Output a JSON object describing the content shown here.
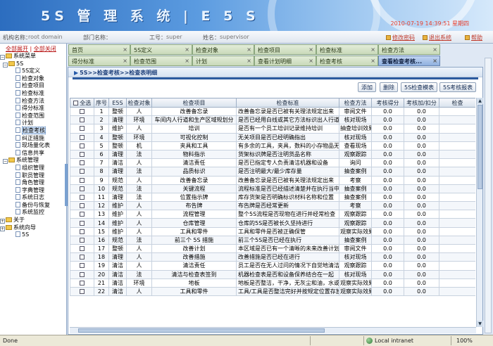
{
  "banner": {
    "title": "5S 管 理 系 统 | E 5 S",
    "datetime": "2010-07-19 14:39:51 星期四"
  },
  "infobar": {
    "org_label": "机构名称：",
    "org_value": "root domain",
    "dept_label": "部门名称：",
    "dept_value": "",
    "emp_label": "工号：",
    "emp_value": "super",
    "name_label": "姓名：",
    "name_value": "supervisor",
    "change_pwd": "修改密码",
    "logout": "退出系统",
    "help": "帮助"
  },
  "sidebar": {
    "expand_all": "全部展开",
    "collapse_all": "全部关闭",
    "items": [
      {
        "label": "系统菜单",
        "level": 0,
        "type": "folder"
      },
      {
        "label": "5S",
        "level": 1,
        "type": "folder"
      },
      {
        "label": "5S定义",
        "level": 2
      },
      {
        "label": "检查对象",
        "level": 2
      },
      {
        "label": "检查项目",
        "level": 2
      },
      {
        "label": "检查标准",
        "level": 2
      },
      {
        "label": "检查方法",
        "level": 2
      },
      {
        "label": "得分标准",
        "level": 2
      },
      {
        "label": "检查范围",
        "level": 2
      },
      {
        "label": "计划",
        "level": 2
      },
      {
        "label": "检查考核",
        "level": 2,
        "selected": true
      },
      {
        "label": "纠正措施",
        "level": 2
      },
      {
        "label": "现场量化表",
        "level": 2
      },
      {
        "label": "信息共享",
        "level": 2
      },
      {
        "label": "系统管理",
        "level": 1,
        "type": "folder"
      },
      {
        "label": "组织管理",
        "level": 2
      },
      {
        "label": "职员管理",
        "level": 2
      },
      {
        "label": "角色管理",
        "level": 2
      },
      {
        "label": "字典管理",
        "level": 2
      },
      {
        "label": "系统日志",
        "level": 2
      },
      {
        "label": "备份与恢复",
        "level": 2
      },
      {
        "label": "系统监控",
        "level": 2
      },
      {
        "label": "关于",
        "level": 0,
        "type": "folder"
      },
      {
        "label": "系统向导",
        "level": 0,
        "type": "folder"
      },
      {
        "label": "5S",
        "level": 2
      }
    ]
  },
  "tabs": {
    "row1": [
      "首页",
      "5S定义",
      "检查对象",
      "检查项目",
      "检查标准",
      "检查方法"
    ],
    "row2": [
      "得分标准",
      "检查范围",
      "计划",
      "查看计划明细",
      "检查考核",
      "查看检查考核..."
    ],
    "active": "查看检查考核..."
  },
  "content": {
    "breadcrumb": "5S>>检查考核>>检查表明细",
    "buttons": {
      "add": "添加",
      "delete": "删除",
      "tpl": "5S检查模表",
      "report": "5S考核报表"
    },
    "columns": [
      "全选",
      "序号",
      "E5S",
      "检查对象",
      "检查项目",
      "检查标准",
      "检查方法",
      "考核得分",
      "考核加/扣分",
      "检查"
    ],
    "rows": [
      [
        "1",
        "整顿",
        "人",
        "改善备忘录",
        "改善备忘录是否已被有关理法规定出来",
        "审阅文件",
        "0.0",
        "0.0"
      ],
      [
        "2",
        "清理",
        "环境",
        "车间内人行道和生产区域规划分",
        "是否已经用白线或其它方法标识出人行道和生产区",
        "核对现场",
        "0.0",
        "0.0"
      ],
      [
        "3",
        "维护",
        "人",
        "培训",
        "是否有一个员工培训记录维持培训",
        "抽查培训效果",
        "0.0",
        "0.0"
      ],
      [
        "4",
        "整顿",
        "环境",
        "可视化控制",
        "无关项目是否已经明确指出",
        "核对现场",
        "0.0",
        "0.0"
      ],
      [
        "5",
        "整顿",
        "机",
        "夹具和工具",
        "有多余的工具，夹具，数料的小存物品无围围",
        "查看现场",
        "0.0",
        "0.0"
      ],
      [
        "6",
        "清理",
        "法",
        "物料指示",
        "货架标识牌是否注明货品名称",
        "观察跟踪",
        "0.0",
        "0.0"
      ],
      [
        "7",
        "清洁",
        "人",
        "清洁责任",
        "是否已指定专人负责清洁机器和设备",
        "询问",
        "0.0",
        "0.0"
      ],
      [
        "8",
        "清理",
        "法",
        "品质标识",
        "是否注明最大/最少库存量",
        "抽查案例",
        "0.0",
        "0.0"
      ],
      [
        "9",
        "规范",
        "人",
        "改善备忘录",
        "改善备忘录是否已被有关理法规定出来",
        "考察",
        "0.0",
        "0.0"
      ],
      [
        "10",
        "规范",
        "法",
        "关键流程",
        "流程标准是否已经描述清楚并在执行当中",
        "抽查案例",
        "0.0",
        "0.0"
      ],
      [
        "11",
        "清理",
        "法",
        "位置指示牌",
        "库存货架是否明确标识材料名称和位置",
        "抽查案例",
        "0.0",
        "0.0"
      ],
      [
        "12",
        "维护",
        "人",
        "布告牌",
        "布告牌是否经常更新",
        "考察",
        "0.0",
        "0.0"
      ],
      [
        "13",
        "维护",
        "人",
        "流程管理",
        "整个5S流程是否现物在进行并经常检查",
        "观察跟踪",
        "0.0",
        "0.0"
      ],
      [
        "14",
        "维护",
        "人",
        "仓库管理",
        "仓库的5S是否被长久坚持进行",
        "观察跟踪",
        "0.0",
        "0.0"
      ],
      [
        "15",
        "维护",
        "人",
        "工具和零件",
        "工具和零件是否被正确保管",
        "观察实际效果",
        "0.0",
        "0.0"
      ],
      [
        "16",
        "规范",
        "法",
        "前三个 5S 措施",
        "前三个5S是否已经在执行",
        "抽查案例",
        "0.0",
        "0.0"
      ],
      [
        "17",
        "整顿",
        "人",
        "改善计划",
        "本区域是否已有一个清晰的未来改善计划",
        "审阅文件",
        "0.0",
        "0.0"
      ],
      [
        "18",
        "清理",
        "人",
        "改善措施",
        "改善措施是否已经在进行",
        "核对现场",
        "0.0",
        "0.0"
      ],
      [
        "19",
        "清洁",
        "人",
        "清洁责任",
        "员工是否在无人过问的情况下自觉地清洁地板和机器",
        "观察跟踪",
        "0.0",
        "0.0"
      ],
      [
        "20",
        "清洁",
        "法",
        "清洁与检查表签到",
        "机器检查表是否和设备保养结合在一起",
        "核对现场",
        "0.0",
        "0.0"
      ],
      [
        "21",
        "清洁",
        "环境",
        "地板",
        "地板是否整洁，干净，无灰尘和油，水或油污",
        "观察实际效果",
        "0.0",
        "0.0"
      ],
      [
        "22",
        "清洁",
        "人",
        "工具和零件",
        "工具/工具是否整洁完好并按规定位置存放",
        "观察实际效果",
        "0.0",
        "0.0"
      ]
    ]
  },
  "statusbar": {
    "left": "Done",
    "zone": "Local intranet",
    "zoom": "100%"
  },
  "colors": {
    "banner": "#2c6dbf",
    "tab_active": "#8fb0df",
    "tab_inactive": "#c9d9b9",
    "link_red": "#c0392b"
  }
}
